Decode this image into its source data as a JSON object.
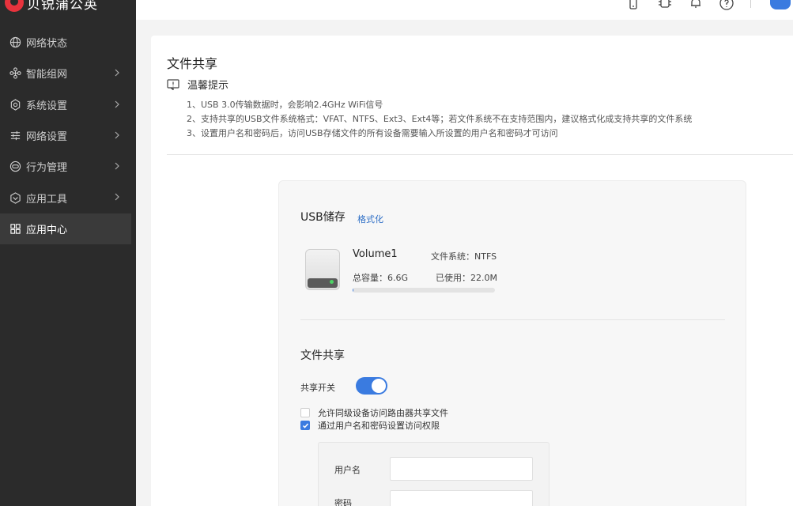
{
  "app": {
    "logo_text": "贝锐蒲公英"
  },
  "sidebar": {
    "items": [
      {
        "label": "网络状态",
        "icon": "globe-icon",
        "has_arrow": false
      },
      {
        "label": "智能组网",
        "icon": "network-icon",
        "has_arrow": true
      },
      {
        "label": "系统设置",
        "icon": "gear-icon",
        "has_arrow": true
      },
      {
        "label": "网络设置",
        "icon": "sliders-icon",
        "has_arrow": true
      },
      {
        "label": "行为管理",
        "icon": "behavior-icon",
        "has_arrow": true
      },
      {
        "label": "应用工具",
        "icon": "tools-icon",
        "has_arrow": true
      },
      {
        "label": "应用中心",
        "icon": "apps-icon",
        "has_arrow": false,
        "active": true
      }
    ]
  },
  "topbar": {
    "icons": [
      "phone-icon",
      "chip-icon",
      "bell-icon",
      "help-icon"
    ],
    "avatar_color": "#3a7be0"
  },
  "page": {
    "title": "文件共享",
    "tip_title": "温馨提示",
    "tips": [
      "1、USB 3.0传输数据时，会影响2.4GHz WiFi信号",
      "2、支持共享的USB文件系统格式：VFAT、NTFS、Ext3、Ext4等；若文件系统不在支持范围内，建议格式化成支持共享的文件系统",
      "3、设置用户名和密码后，访问USB存储文件的所有设备需要输入所设置的用户名和密码才可访问"
    ]
  },
  "usb": {
    "title": "USB储存",
    "format_link": "格式化",
    "volume_name": "Volume1",
    "filesystem": "文件系统：NTFS",
    "total": "总容量：6.6G",
    "used": "已使用：22.0M",
    "usage_fraction": 0.003
  },
  "share": {
    "title": "文件共享",
    "switch_label": "共享开关",
    "switch_on": true,
    "option1": "允许同级设备访问路由器共享文件",
    "option1_checked": false,
    "option2": "通过用户名和密码设置访问权限",
    "option2_checked": true,
    "username_label": "用户名",
    "username_value": "",
    "password_label": "密码",
    "password_value": ""
  },
  "colors": {
    "accent": "#3a7be0",
    "sidebar_bg": "#2b2b2b",
    "brand": "#e8333d",
    "led": "#4cd364"
  }
}
